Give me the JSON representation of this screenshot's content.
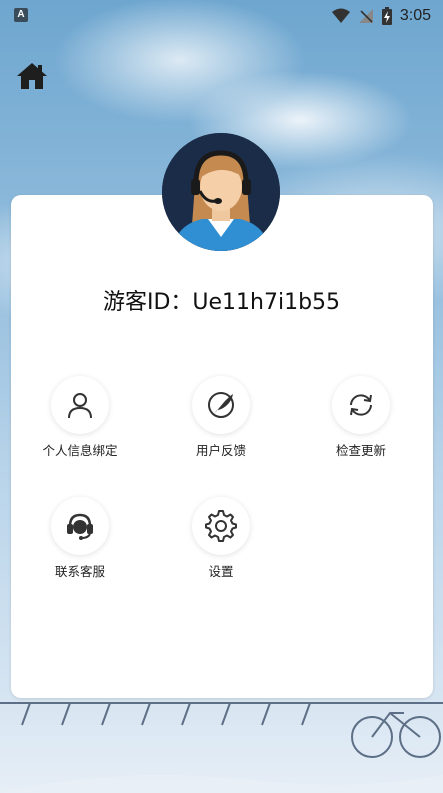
{
  "status_bar": {
    "left_badge": "A",
    "time": "3:05",
    "icons": [
      "wifi-icon",
      "no-signal-icon",
      "battery-charging-icon"
    ]
  },
  "header": {
    "home_icon": "home-icon"
  },
  "profile": {
    "avatar": "customer-service-avatar",
    "guest_id": "游客ID：Ue11h7i1b55"
  },
  "menu": {
    "items": [
      {
        "label": "个人信息绑定",
        "icon": "user-icon"
      },
      {
        "label": "用户反馈",
        "icon": "feather-icon"
      },
      {
        "label": "检查更新",
        "icon": "refresh-icon"
      },
      {
        "label": "联系客服",
        "icon": "headset-icon"
      },
      {
        "label": "设置",
        "icon": "gear-icon"
      }
    ]
  },
  "colors": {
    "card_bg": "#ffffff",
    "icon_stroke": "#333333",
    "text": "#111111"
  }
}
